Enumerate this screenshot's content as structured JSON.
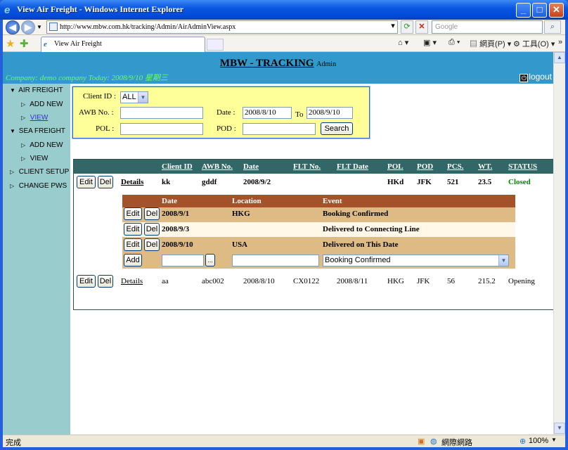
{
  "window": {
    "title": "View Air Freight - Windows Internet Explorer",
    "address": "http://www.mbw.com.hk/tracking/Admin/AirAdminView.aspx",
    "search_placeholder": "Google",
    "tab_title": "View Air Freight",
    "cmd_page": "網頁(P)",
    "cmd_tools": "工具(O)",
    "status_text": "完成",
    "status_zone": "網際網路",
    "status_zoom": "100%"
  },
  "header": {
    "brand": "MBW - TRACKING",
    "role": "Admin",
    "company_line": "Company: demo company Today: 2008/9/10 星期三",
    "logout_label": "logout"
  },
  "sidebar": {
    "air_freight": "AIR FREIGHT",
    "air_add": "ADD NEW",
    "air_view": "VIEW",
    "sea_freight": "SEA FREIGHT",
    "sea_add": "ADD NEW",
    "sea_view": "VIEW",
    "client_setup": "CLIENT SETUP",
    "change_pws": "CHANGE PWS"
  },
  "filter": {
    "client_id_label": "Client ID :",
    "client_id_value": "ALL",
    "awb_label": "AWB No. :",
    "awb_value": "",
    "date_label": "Date :",
    "date_from": "2008/8/10",
    "date_to_label": "To",
    "date_to": "2008/9/10",
    "pol_label": "POL :",
    "pol_value": "",
    "pod_label": "POD :",
    "pod_value": "",
    "search_label": "Search"
  },
  "table": {
    "headers": {
      "client_id": "Client ID",
      "awb": "AWB No.",
      "date": "Date",
      "flt_no": "FLT No.",
      "flt_date": "FLT Date",
      "pol": "POL",
      "pod": "POD",
      "pcs": "PCS.",
      "wt": "WT.",
      "status": "STATUS"
    },
    "edit_label": "Edit",
    "del_label": "Del",
    "details_label": "Details",
    "rows": [
      {
        "client_id": "kk",
        "awb": "gddf",
        "date": "2008/9/2",
        "flt_no": "",
        "flt_date": "",
        "pol": "HKd",
        "pod": "JFK",
        "pcs": "521",
        "wt": "23.5",
        "status": "Closed"
      },
      {
        "client_id": "aa",
        "awb": "abc002",
        "date": "2008/8/10",
        "flt_no": "CX0122",
        "flt_date": "2008/8/11",
        "pol": "HKG",
        "pod": "JFK",
        "pcs": "56",
        "wt": "215.2",
        "status": "Opening"
      }
    ]
  },
  "events": {
    "headers": {
      "date": "Date",
      "location": "Location",
      "event": "Event"
    },
    "rows": [
      {
        "date": "2008/9/1",
        "location": "HKG",
        "event": "Booking Confirmed"
      },
      {
        "date": "2008/9/3",
        "location": "",
        "event": "Delivered to Connecting Line"
      },
      {
        "date": "2008/9/10",
        "location": "USA",
        "event": "Delivered on This Date"
      }
    ],
    "add_label": "Add",
    "picker_label": "...",
    "event_select_value": "Booking Confirmed"
  },
  "colors": {
    "header_bg": "#3399cc",
    "sidebar_bg": "#99cccc",
    "filter_bg": "#ffff99",
    "table_header_bg": "#336666",
    "sub_header_bg": "#a55129",
    "sub_body_bg": "#deba84",
    "status_closed": "#008800"
  }
}
